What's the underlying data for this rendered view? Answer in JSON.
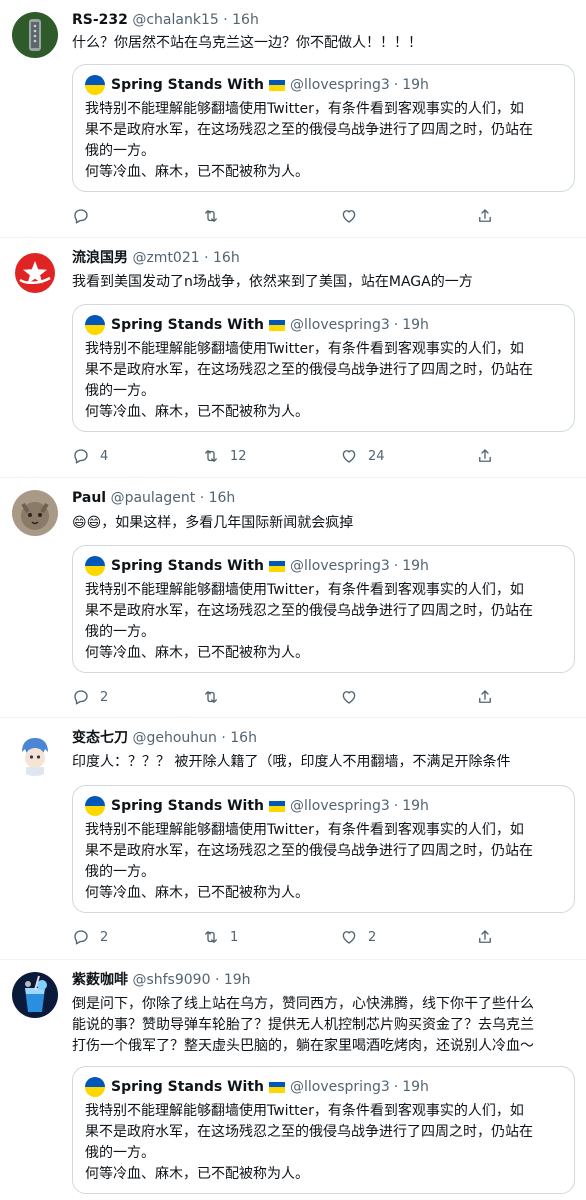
{
  "quoted": {
    "name": "Spring Stands With",
    "handle": "@llovespring3",
    "time": "19h",
    "text_line1": "我特别不能理解能够翻墙使用Twitter，有条件看到客观事实的人们，如",
    "text_line2": "果不是政府水军，在这场残忍之至的俄侵乌战争进行了四周之时，仍站在",
    "text_line3": "俄的一方。",
    "text_line4": "何等冷血、麻木，已不配被称为人。",
    "flag_colors": [
      "#0057b7",
      "#ffd700"
    ]
  },
  "tweets": [
    {
      "name": "RS-232",
      "handle": "@chalank15",
      "time": "16h",
      "text_lines": [
        "什么？你居然不站在乌克兰这一边？你不配做人！！！！"
      ],
      "replies": "",
      "retweets": "",
      "likes": ""
    },
    {
      "name": "流浪国男",
      "handle": "@zmt021",
      "time": "16h",
      "text_lines": [
        "我看到美国发动了n场战争，依然来到了美国，站在MAGA的一方"
      ],
      "replies": "4",
      "retweets": "12",
      "likes": "24"
    },
    {
      "name": "Paul",
      "handle": "@paulagent",
      "time": "16h",
      "text_lines": [
        "😄😄，如果这样，多看几年国际新闻就会疯掉"
      ],
      "replies": "2",
      "retweets": "",
      "likes": ""
    },
    {
      "name": "变态七刀",
      "handle": "@gehouhun",
      "time": "16h",
      "text_lines": [
        "印度人：？？？ 被开除人籍了（哦，印度人不用翻墙，不满足开除条件"
      ],
      "replies": "2",
      "retweets": "1",
      "likes": "2"
    },
    {
      "name": "紫薮咖啡",
      "handle": "@shfs9090",
      "time": "19h",
      "text_lines": [
        "倒是问下，你除了线上站在乌方，赞同西方，心快沸腾，线下你干了些什么",
        "能说的事？赞助导弹车轮胎了？提供无人机控制芯片购买资金了？去乌克兰",
        "打伤一个俄军了？整天虚头巴脑的，躺在家里喝酒吃烤肉，还说别人冷血～"
      ],
      "replies": "",
      "retweets": "",
      "likes": ""
    }
  ],
  "colors": {
    "text": "#0f1419",
    "muted": "#536471",
    "border": "#cfd9de"
  },
  "icons": [
    "reply-icon",
    "retweet-icon",
    "like-icon",
    "share-icon"
  ]
}
